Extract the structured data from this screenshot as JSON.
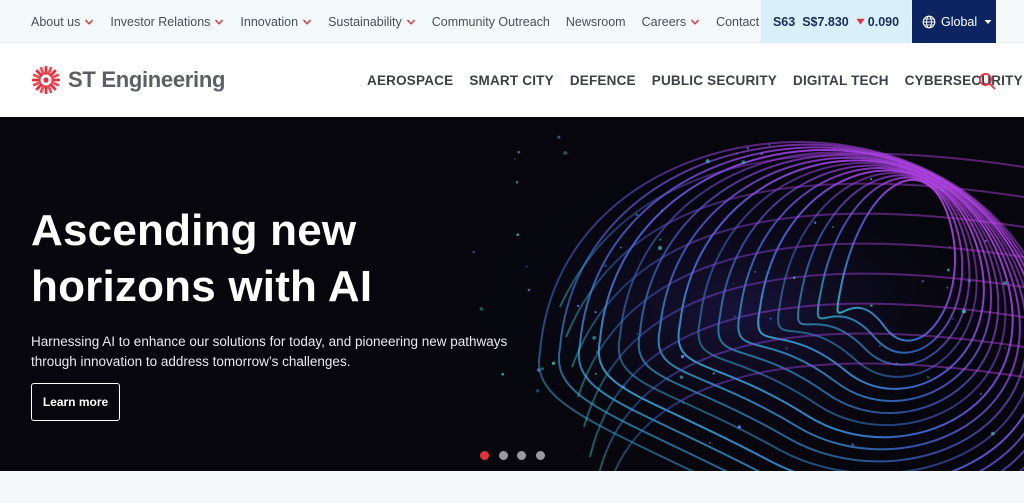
{
  "topnav": {
    "items": [
      {
        "label": "About us",
        "dropdown": true
      },
      {
        "label": "Investor Relations",
        "dropdown": true
      },
      {
        "label": "Innovation",
        "dropdown": true
      },
      {
        "label": "Sustainability",
        "dropdown": true
      },
      {
        "label": "Community Outreach",
        "dropdown": false
      },
      {
        "label": "Newsroom",
        "dropdown": false
      },
      {
        "label": "Careers",
        "dropdown": true
      },
      {
        "label": "Contact us",
        "dropdown": false
      }
    ]
  },
  "stock": {
    "ticker": "S63",
    "price": "S$7.830",
    "change": "0.090",
    "direction": "down"
  },
  "region": {
    "label": "Global"
  },
  "header": {
    "brand": "ST Engineering",
    "nav": [
      "AEROSPACE",
      "SMART CITY",
      "DEFENCE",
      "PUBLIC SECURITY",
      "DIGITAL TECH",
      "CYBERSECURITY"
    ]
  },
  "hero": {
    "title": "Ascending new horizons with AI",
    "subtitle": "Harnessing AI to enhance our solutions for today, and pioneering new pathways through innovation to address tomorrow’s challenges.",
    "cta": "Learn more",
    "slides": 4,
    "active_slide": 1
  },
  "colors": {
    "accent": "#e2313f",
    "navy": "#0d2463",
    "stock_bg": "#d9f0fa",
    "hero_bg": "#06060c"
  }
}
